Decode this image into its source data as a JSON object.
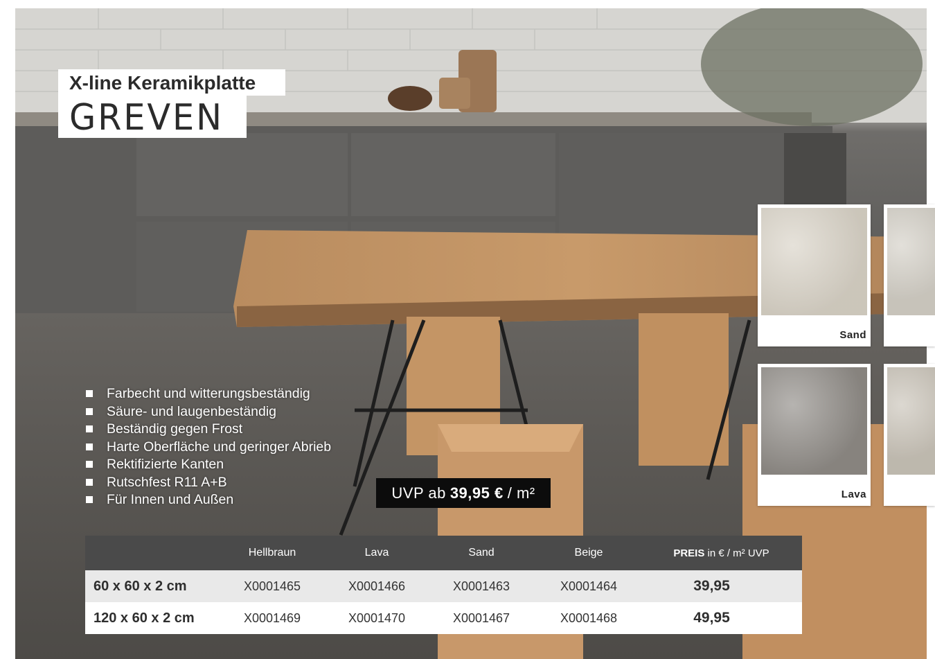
{
  "title": {
    "line1": "X-line Keramikplatte",
    "line2": "GREVEN"
  },
  "features": [
    "Farbecht und witterungsbeständig",
    "Säure- und laugenbeständig",
    "Beständig gegen Frost",
    "Harte Oberfläche und geringer Abrieb",
    "Rektifizierte Kanten",
    "Rutschfest R11 A+B",
    "Für Innen und Außen"
  ],
  "price_badge": {
    "prefix": "UVP ab",
    "amount": "39,95 €",
    "suffix": "/ m²"
  },
  "swatches": [
    {
      "label": "Sand",
      "color": "#d8d2c6"
    },
    {
      "label": "",
      "color": "#d3cfc6"
    },
    {
      "label": "Lava",
      "color": "#8f8b86"
    },
    {
      "label": "",
      "color": "#c9c3b8"
    }
  ],
  "table": {
    "headers": [
      "",
      "Hellbraun",
      "Lava",
      "Sand",
      "Beige"
    ],
    "price_header": {
      "bold": "PREIS",
      "rest": "in € / m²  UVP"
    },
    "rows": [
      {
        "size": "60 x 60 x 2 cm",
        "codes": [
          "X0001465",
          "X0001466",
          "X0001463",
          "X0001464"
        ],
        "price": "39,95"
      },
      {
        "size": "120 x 60 x 2 cm",
        "codes": [
          "X0001469",
          "X0001470",
          "X0001467",
          "X0001468"
        ],
        "price": "49,95"
      }
    ]
  },
  "colors": {
    "header_bg": "#4a4a4a",
    "row1_bg": "#e9e9e9",
    "badge_bg": "#0c0c0c"
  }
}
